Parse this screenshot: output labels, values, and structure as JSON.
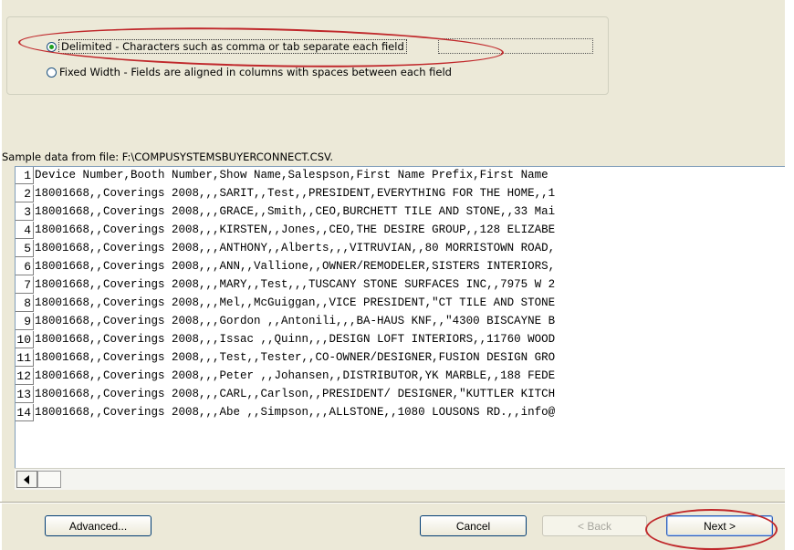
{
  "file_type_options": {
    "delimited": {
      "label": "Delimited - Characters such as comma or tab separate each field",
      "selected": true
    },
    "fixed_width": {
      "label": "Fixed Width - Fields are aligned in columns with spaces between each field",
      "selected": false
    }
  },
  "preview": {
    "caption": "Sample data from file: F:\\COMPUSYSTEMSBUYERCONNECT.CSV.",
    "rows": [
      {
        "num": "1",
        "text": "Device Number,Booth Number,Show Name,Salesp​son,First Name Prefix,First Name"
      },
      {
        "num": "2",
        "text": "18001668,,Coverings 2008,,,SARIT,,Test,,PRESIDENT,EVERYTHING FOR THE HOME,,1"
      },
      {
        "num": "3",
        "text": "18001668,,Coverings 2008,,,GRACE,,Smith,,CEO,BURCHETT TILE AND STONE,,33 Mai"
      },
      {
        "num": "4",
        "text": "18001668,,Coverings 2008,,,KIRSTEN,,Jones,,CEO,THE DESIRE GROUP,,128 ELIZABE"
      },
      {
        "num": "5",
        "text": "18001668,,Coverings 2008,,,ANTHONY,,Alberts,,,VITRUVIAN,,80 MORRISTOWN ROAD,"
      },
      {
        "num": "6",
        "text": "18001668,,Coverings 2008,,,ANN,,Vallione,,OWNER/REMODELER,SISTERS INTERIORS,"
      },
      {
        "num": "7",
        "text": "18001668,,Coverings 2008,,,MARY,,Test,,,TUSCANY STONE SURFACES INC,,7975 W 2"
      },
      {
        "num": "8",
        "text": "18001668,,Coverings 2008,,,Mel,,McGuiggan,,VICE PRESIDENT,\"CT TILE AND STONE"
      },
      {
        "num": "9",
        "text": "18001668,,Coverings 2008,,,Gordon ,,Antonili,,,BA-HAUS KNF,,\"4300 BISCAYNE B"
      },
      {
        "num": "10",
        "text": "18001668,,Coverings 2008,,,Issac ,,Quinn,,,DESIGN LOFT INTERIORS,,11760 WOOD"
      },
      {
        "num": "11",
        "text": "18001668,,Coverings 2008,,,Test,,Tester,,CO-OWNER/DESIGNER,FUSION DESIGN GRO"
      },
      {
        "num": "12",
        "text": "18001668,,Coverings 2008,,,Peter ,,Johansen,,DISTRIBUTOR,YK MARBLE,,188 FEDE"
      },
      {
        "num": "13",
        "text": "18001668,,Coverings 2008,,,CARL,,Carlson,,PRESIDENT/ DESIGNER,\"KUTTLER KITCH"
      },
      {
        "num": "14",
        "text": "18001668,,Coverings 2008,,,Abe ,,Simpson,,,ALLSTONE,,1080 LOUSONS RD.,,info@"
      }
    ]
  },
  "buttons": {
    "advanced": "Advanced...",
    "cancel": "Cancel",
    "back": "< Back",
    "next": "Next >"
  },
  "colors": {
    "dialog_background": "#ece9d8",
    "annotation": "#c0282b",
    "radio_selected": "#21a121"
  }
}
